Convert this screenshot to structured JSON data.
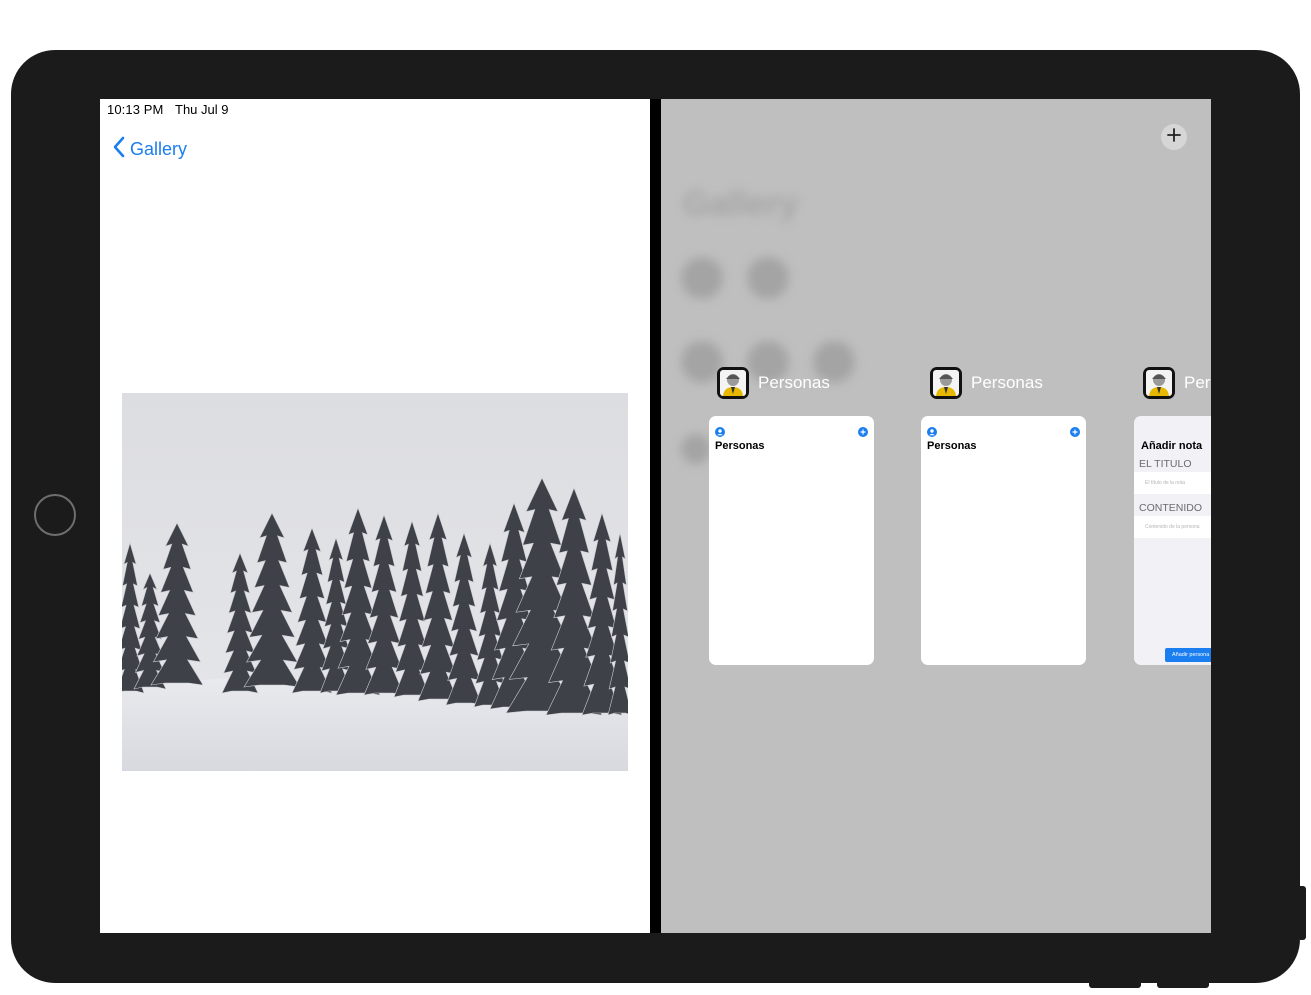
{
  "status_bar": {
    "time": "10:13 PM",
    "date": "Thu Jul 9"
  },
  "left_pane": {
    "back_label": "Gallery"
  },
  "right_pane": {
    "background_title": "Gallery",
    "add_icon": "plus-icon",
    "apps": [
      {
        "name": "Personas",
        "card_title": "Personas"
      },
      {
        "name": "Personas",
        "card_title": "Personas"
      },
      {
        "name": "Personas"
      }
    ],
    "note_card": {
      "title": "Añadir nota",
      "label_title": "EL TITULO",
      "placeholder_title": "El título de la nota",
      "label_content": "CONTENIDO",
      "placeholder_content": "Contenido de la persona",
      "button": "Añadir persona"
    }
  },
  "colors": {
    "accent": "#1a7df0",
    "device_frame": "#1b1b1b",
    "dim_background": "#bfbfbf",
    "app_icon_yellow": "#e6b800"
  }
}
